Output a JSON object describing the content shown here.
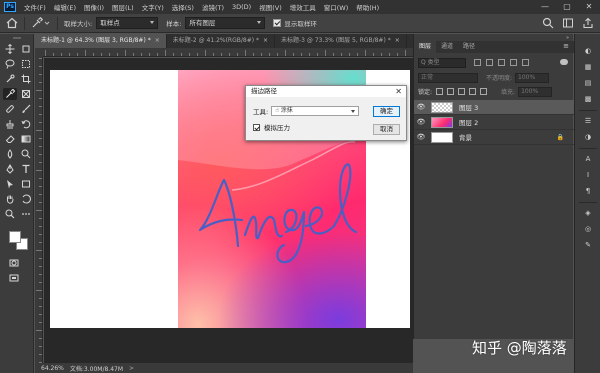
{
  "menubar": {
    "logo": "Ps",
    "items": [
      "文件(F)",
      "编辑(E)",
      "图像(I)",
      "图层(L)",
      "文字(Y)",
      "选择(S)",
      "滤镜(T)",
      "3D(D)",
      "视图(V)",
      "增效工具",
      "窗口(W)",
      "帮助(H)"
    ],
    "window_controls": [
      "—",
      "▢",
      "✕"
    ]
  },
  "options": {
    "sample_size_label": "取样大小:",
    "sample_size_value": "取样点",
    "sample_label": "样本:",
    "sample_value": "所有图层",
    "show_ring_label": "显示取样环",
    "show_ring_checked": true
  },
  "tabs": [
    {
      "label": "未标题-1 @ 64.3% (图层 3, RGB/8#) *",
      "close": "×",
      "active": true
    },
    {
      "label": "未标题-2 @ 41.2%(RGB/8#) *",
      "close": "×",
      "active": false
    },
    {
      "label": "未标题-3 @ 73.3% (图层 5, RGB/8#) *",
      "close": "×",
      "active": false
    }
  ],
  "canvas": {
    "script_text": "Angel",
    "stroke_color": "#4a5fc4"
  },
  "dialog": {
    "title": "描边路径",
    "close": "✕",
    "tool_label": "工具:",
    "tool_value": "涂抹",
    "simulate_pressure_label": "模拟压力",
    "simulate_pressure_checked": true,
    "ok_label": "确定",
    "cancel_label": "取消"
  },
  "layers_panel": {
    "collapse": "»",
    "tabs": [
      "图层",
      "通道",
      "路径"
    ],
    "menu": "≡",
    "filter_placeholder": "Q 类型",
    "blend_mode": "正常",
    "opacity_label": "不透明度:",
    "opacity_value": "100%",
    "lock_label": "锁定:",
    "fill_label": "填充:",
    "fill_value": "100%",
    "layers": [
      {
        "name": "图层 3",
        "thumb": "checker",
        "selected": true,
        "locked": false
      },
      {
        "name": "图层 2",
        "thumb": "art",
        "selected": false,
        "locked": false
      },
      {
        "name": "背景",
        "thumb": "white",
        "selected": false,
        "locked": true
      }
    ]
  },
  "status": {
    "zoom": "64.26%",
    "doc_info": "文档:3.00M/8.47M",
    "arrow": ">"
  },
  "watermark": "知乎 @陶落落",
  "colors": {
    "accent": "#31a8ff",
    "ui_dark": "#323232",
    "panel": "#3c3c3c",
    "workspace": "#535353"
  }
}
